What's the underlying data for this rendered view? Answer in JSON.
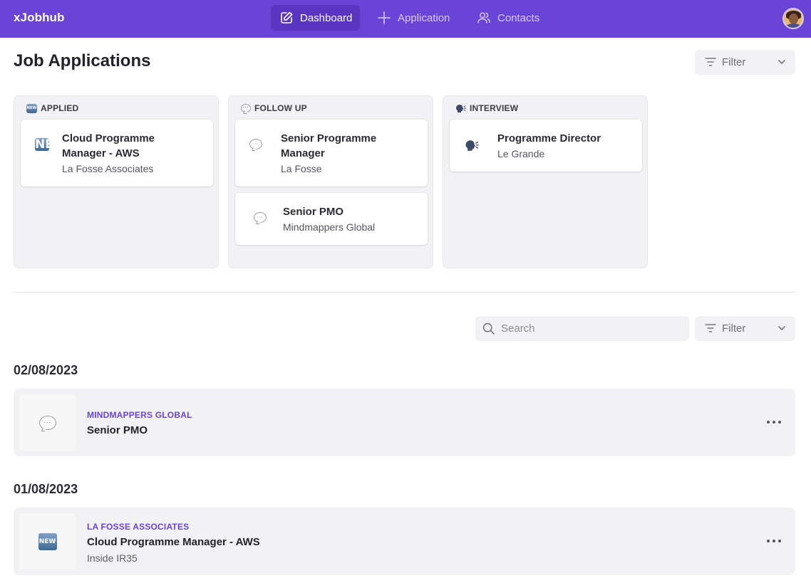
{
  "app": {
    "brand": "xJobhub"
  },
  "nav": {
    "items": [
      {
        "label": "Dashboard",
        "icon": "edit-icon",
        "active": true
      },
      {
        "label": "Application",
        "icon": "plus-icon",
        "active": false
      },
      {
        "label": "Contacts",
        "icon": "users-icon",
        "active": false
      }
    ]
  },
  "header": {
    "title": "Job Applications",
    "filter_label": "Filter"
  },
  "board": {
    "columns": [
      {
        "label": "APPLIED",
        "icon": "new-badge-icon",
        "cards": [
          {
            "title": "Cloud Programme Manager - AWS",
            "company": "La Fosse Associates",
            "icon": "new-badge-icon"
          }
        ]
      },
      {
        "label": "FOLLOW UP",
        "icon": "speech-bubble-icon",
        "cards": [
          {
            "title": "Senior Programme Manager",
            "company": "La Fosse",
            "icon": "speech-bubble-icon"
          },
          {
            "title": "Senior PMO",
            "company": "Mindmappers Global",
            "icon": "speech-bubble-icon"
          }
        ]
      },
      {
        "label": "INTERVIEW",
        "icon": "speaking-head-icon",
        "cards": [
          {
            "title": "Programme Director",
            "company": "Le Grande",
            "icon": "speaking-head-icon"
          }
        ]
      }
    ]
  },
  "list_controls": {
    "search_placeholder": "Search",
    "filter_label": "Filter"
  },
  "groups": [
    {
      "date": "02/08/2023",
      "items": [
        {
          "company": "MINDMAPPERS GLOBAL",
          "title": "Senior PMO",
          "note": "",
          "icon": "speech-bubble-icon"
        }
      ]
    },
    {
      "date": "01/08/2023",
      "items": [
        {
          "company": "LA FOSSE ASSOCIATES",
          "title": "Cloud Programme Manager - AWS",
          "note": "Inside IR35",
          "icon": "new-badge-icon"
        }
      ]
    }
  ],
  "colors": {
    "brand": "#6a44d6",
    "nav_active": "#5a35c2",
    "surface": "#f2f2f4"
  }
}
